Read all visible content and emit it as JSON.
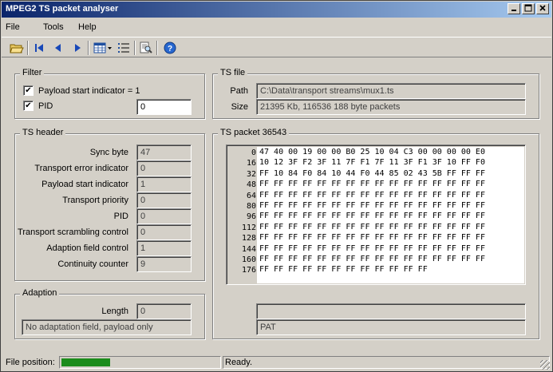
{
  "window": {
    "title": "MPEG2 TS packet analyser"
  },
  "menu": {
    "file": "File",
    "tools": "Tools",
    "help": "Help"
  },
  "toolbar": {
    "icons": [
      "open-folder-icon",
      "first-packet-icon",
      "previous-packet-icon",
      "next-packet-icon",
      "view-grid-icon",
      "list-icon",
      "find-icon",
      "help-icon"
    ]
  },
  "filter": {
    "title": "Filter",
    "payload_start_label": "Payload start indicator = 1",
    "payload_start_checked": true,
    "pid_label": "PID",
    "pid_checked": true,
    "pid_value": "0"
  },
  "ts_file": {
    "title": "TS file",
    "path_label": "Path",
    "path_value": "C:\\Data\\transport streams\\mux1.ts",
    "size_label": "Size",
    "size_value": "21395 Kb, 116536 188 byte packets"
  },
  "ts_header": {
    "title": "TS header",
    "fields": [
      {
        "label": "Sync byte",
        "value": "47"
      },
      {
        "label": "Transport error indicator",
        "value": "0"
      },
      {
        "label": "Payload start indicator",
        "value": "1"
      },
      {
        "label": "Transport priority",
        "value": "0"
      },
      {
        "label": "PID",
        "value": "0"
      },
      {
        "label": "Transport scrambling control",
        "value": "0"
      },
      {
        "label": "Adaption field control",
        "value": "1"
      },
      {
        "label": "Continuity counter",
        "value": "9"
      }
    ]
  },
  "adaption": {
    "title": "Adaption",
    "length_label": "Length",
    "length_value": "0",
    "description": "No adaptation field, payload only"
  },
  "ts_packet": {
    "title": "TS packet 36543",
    "offsets": [
      "0",
      "16",
      "32",
      "48",
      "64",
      "80",
      "96",
      "112",
      "128",
      "144",
      "160",
      "176"
    ],
    "rows": [
      "47 40 00 19 00 00 B0 25 10 04 C3 00 00 00 00 E0",
      "10 12 3F F2 3F 11 7F F1 7F 11 3F F1 3F 10 FF F0",
      "FF 10 84 F0 84 10 44 F0 44 85 02 43 5B FF FF FF",
      "FF FF FF FF FF FF FF FF FF FF FF FF FF FF FF FF",
      "FF FF FF FF FF FF FF FF FF FF FF FF FF FF FF FF",
      "FF FF FF FF FF FF FF FF FF FF FF FF FF FF FF FF",
      "FF FF FF FF FF FF FF FF FF FF FF FF FF FF FF FF",
      "FF FF FF FF FF FF FF FF FF FF FF FF FF FF FF FF",
      "FF FF FF FF FF FF FF FF FF FF FF FF FF FF FF FF",
      "FF FF FF FF FF FF FF FF FF FF FF FF FF FF FF FF",
      "FF FF FF FF FF FF FF FF FF FF FF FF FF FF FF FF",
      "FF FF FF FF FF FF FF FF FF FF FF FF"
    ],
    "info_field": "",
    "table_name": "PAT"
  },
  "status": {
    "file_position_label": "File position:",
    "progress": 0.31,
    "progress_color": "#1c8c1c",
    "message": "Ready."
  }
}
